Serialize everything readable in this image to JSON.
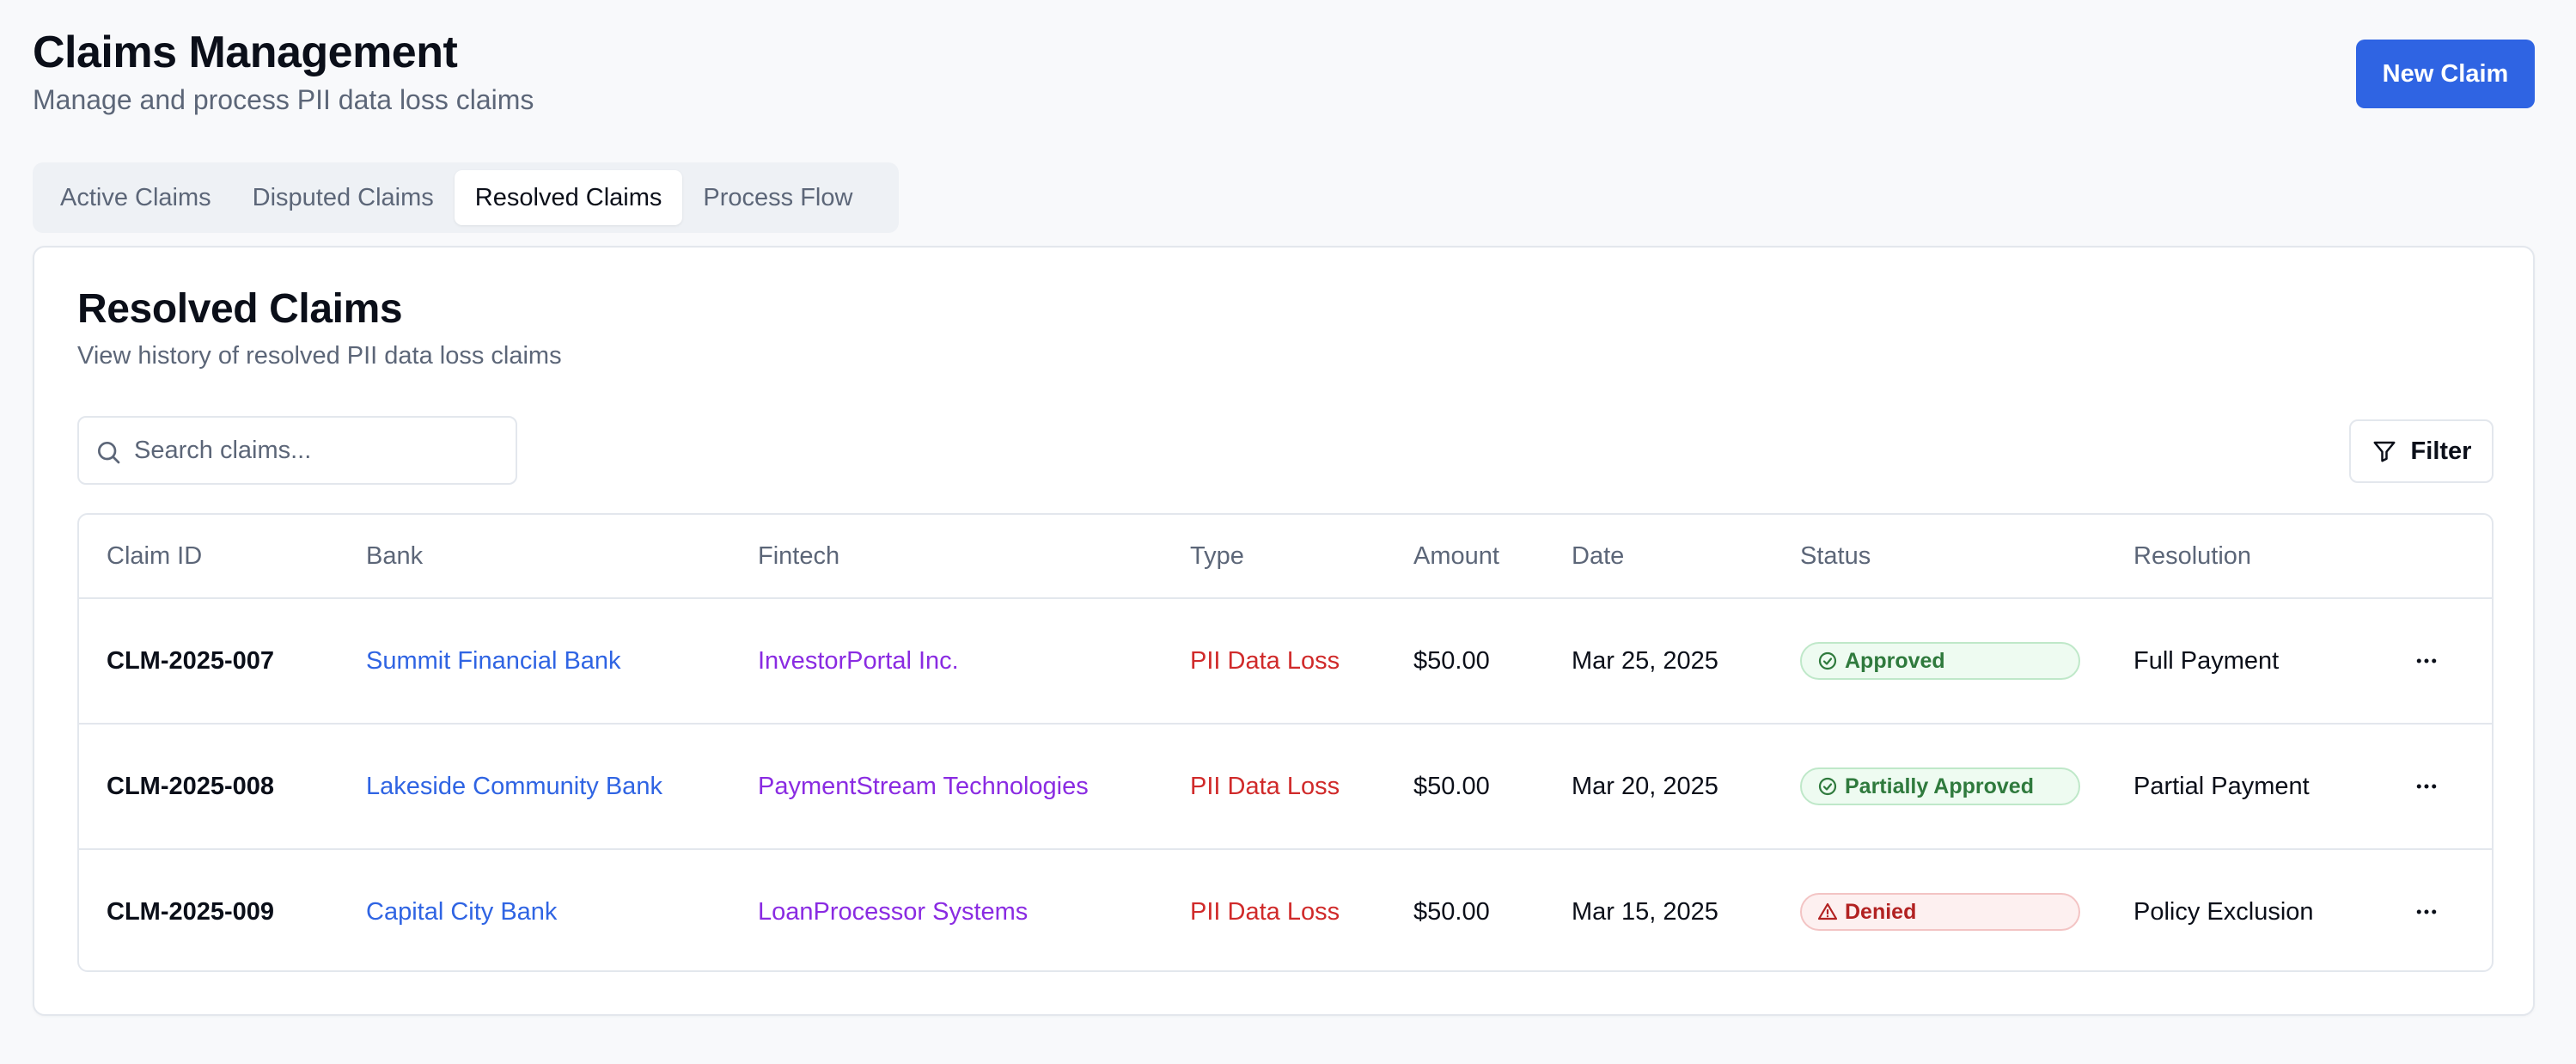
{
  "header": {
    "title": "Claims Management",
    "subtitle": "Manage and process PII data loss claims",
    "new_claim_label": "New Claim"
  },
  "tabs": [
    {
      "label": "Active Claims",
      "active": false
    },
    {
      "label": "Disputed Claims",
      "active": false
    },
    {
      "label": "Resolved Claims",
      "active": true
    },
    {
      "label": "Process Flow",
      "active": false
    }
  ],
  "card": {
    "title": "Resolved Claims",
    "subtitle": "View history of resolved PII data loss claims",
    "search_placeholder": "Search claims...",
    "filter_label": "Filter"
  },
  "table": {
    "columns": [
      "Claim ID",
      "Bank",
      "Fintech",
      "Type",
      "Amount",
      "Date",
      "Status",
      "Resolution"
    ],
    "rows": [
      {
        "id": "CLM-2025-007",
        "bank": "Summit Financial Bank",
        "fintech": "InvestorPortal Inc.",
        "type": "PII Data Loss",
        "amount": "$50.00",
        "date": "Mar 25, 2025",
        "status": "Approved",
        "status_icon": "check-circle-icon",
        "status_color": "#2f7a3d",
        "resolution": "Full Payment"
      },
      {
        "id": "CLM-2025-008",
        "bank": "Lakeside Community Bank",
        "fintech": "PaymentStream Technologies",
        "type": "PII Data Loss",
        "amount": "$50.00",
        "date": "Mar 20, 2025",
        "status": "Partially Approved",
        "status_icon": "check-circle-icon",
        "status_color": "#2f7a3d",
        "resolution": "Partial Payment"
      },
      {
        "id": "CLM-2025-009",
        "bank": "Capital City Bank",
        "fintech": "LoanProcessor Systems",
        "type": "PII Data Loss",
        "amount": "$50.00",
        "date": "Mar 15, 2025",
        "status": "Denied",
        "status_icon": "warning-triangle-icon",
        "status_color": "#b22222",
        "resolution": "Policy Exclusion"
      }
    ]
  },
  "colors": {
    "accent": "#2f64e3",
    "bank_link": "#2f64e3",
    "fintech_link": "#8a2be2",
    "type_text": "#d02a2a"
  }
}
